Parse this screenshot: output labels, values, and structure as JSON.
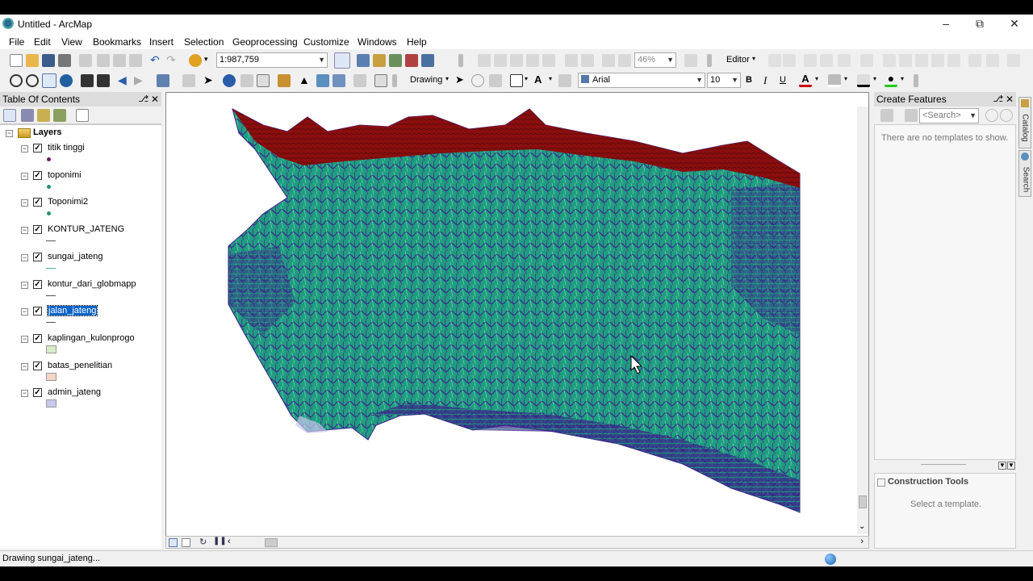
{
  "window": {
    "title": "Untitled - ArcMap",
    "min": "–",
    "max": "⧉",
    "close": "✕"
  },
  "menu": [
    "File",
    "Edit",
    "View",
    "Bookmarks",
    "Insert",
    "Selection",
    "Geoprocessing",
    "Customize",
    "Windows",
    "Help"
  ],
  "toolbar": {
    "scale": "1:987,759",
    "zoom_pct": "46%",
    "editor_label": "Editor",
    "drawing_label": "Drawing",
    "font_name": "Arial",
    "font_size": "10",
    "bold": "B",
    "italic": "I",
    "underline": "U",
    "text_tool": "A"
  },
  "toc": {
    "title": "Table Of Contents",
    "root": "Layers",
    "layers": [
      {
        "name": "titik tinggi",
        "checked": true,
        "symbol": "point",
        "color": "#6b1f6b"
      },
      {
        "name": "toponimi",
        "checked": true,
        "symbol": "point",
        "color": "#2a8f7a"
      },
      {
        "name": "Toponimi2",
        "checked": true,
        "symbol": "point",
        "color": "#2a8f7a"
      },
      {
        "name": "KONTUR_JATENG",
        "checked": true,
        "symbol": "line",
        "color": "#555555"
      },
      {
        "name": "sungai_jateng",
        "checked": true,
        "symbol": "line",
        "color": "#3cb5a5"
      },
      {
        "name": "kontur_dari_globmapp",
        "checked": true,
        "symbol": "line",
        "color": "#555555"
      },
      {
        "name": "jalan_jateng",
        "checked": true,
        "symbol": "line",
        "color": "#555555",
        "selected": true
      },
      {
        "name": "kaplingan_kulonprogo",
        "checked": true,
        "symbol": "polygon",
        "color": "#d8ecc8"
      },
      {
        "name": "batas_penelitian",
        "checked": true,
        "symbol": "polygon",
        "color": "#f5d5c5"
      },
      {
        "name": "admin_jateng",
        "checked": true,
        "symbol": "polygon",
        "color": "#c8c8ec"
      }
    ]
  },
  "create_features": {
    "title": "Create Features",
    "search_placeholder": "<Search>",
    "empty_text": "There are no templates to show.",
    "construction_title": "Construction Tools",
    "construction_text": "Select a template."
  },
  "side_tabs": [
    "Catalog",
    "Search"
  ],
  "status": {
    "text": "Drawing sungai_jateng..."
  },
  "colors": {
    "map_fill": "#1f9e7f",
    "contour": "#3a1c8a",
    "coast": "#8b0e0e",
    "selection": "#0a64c8"
  }
}
